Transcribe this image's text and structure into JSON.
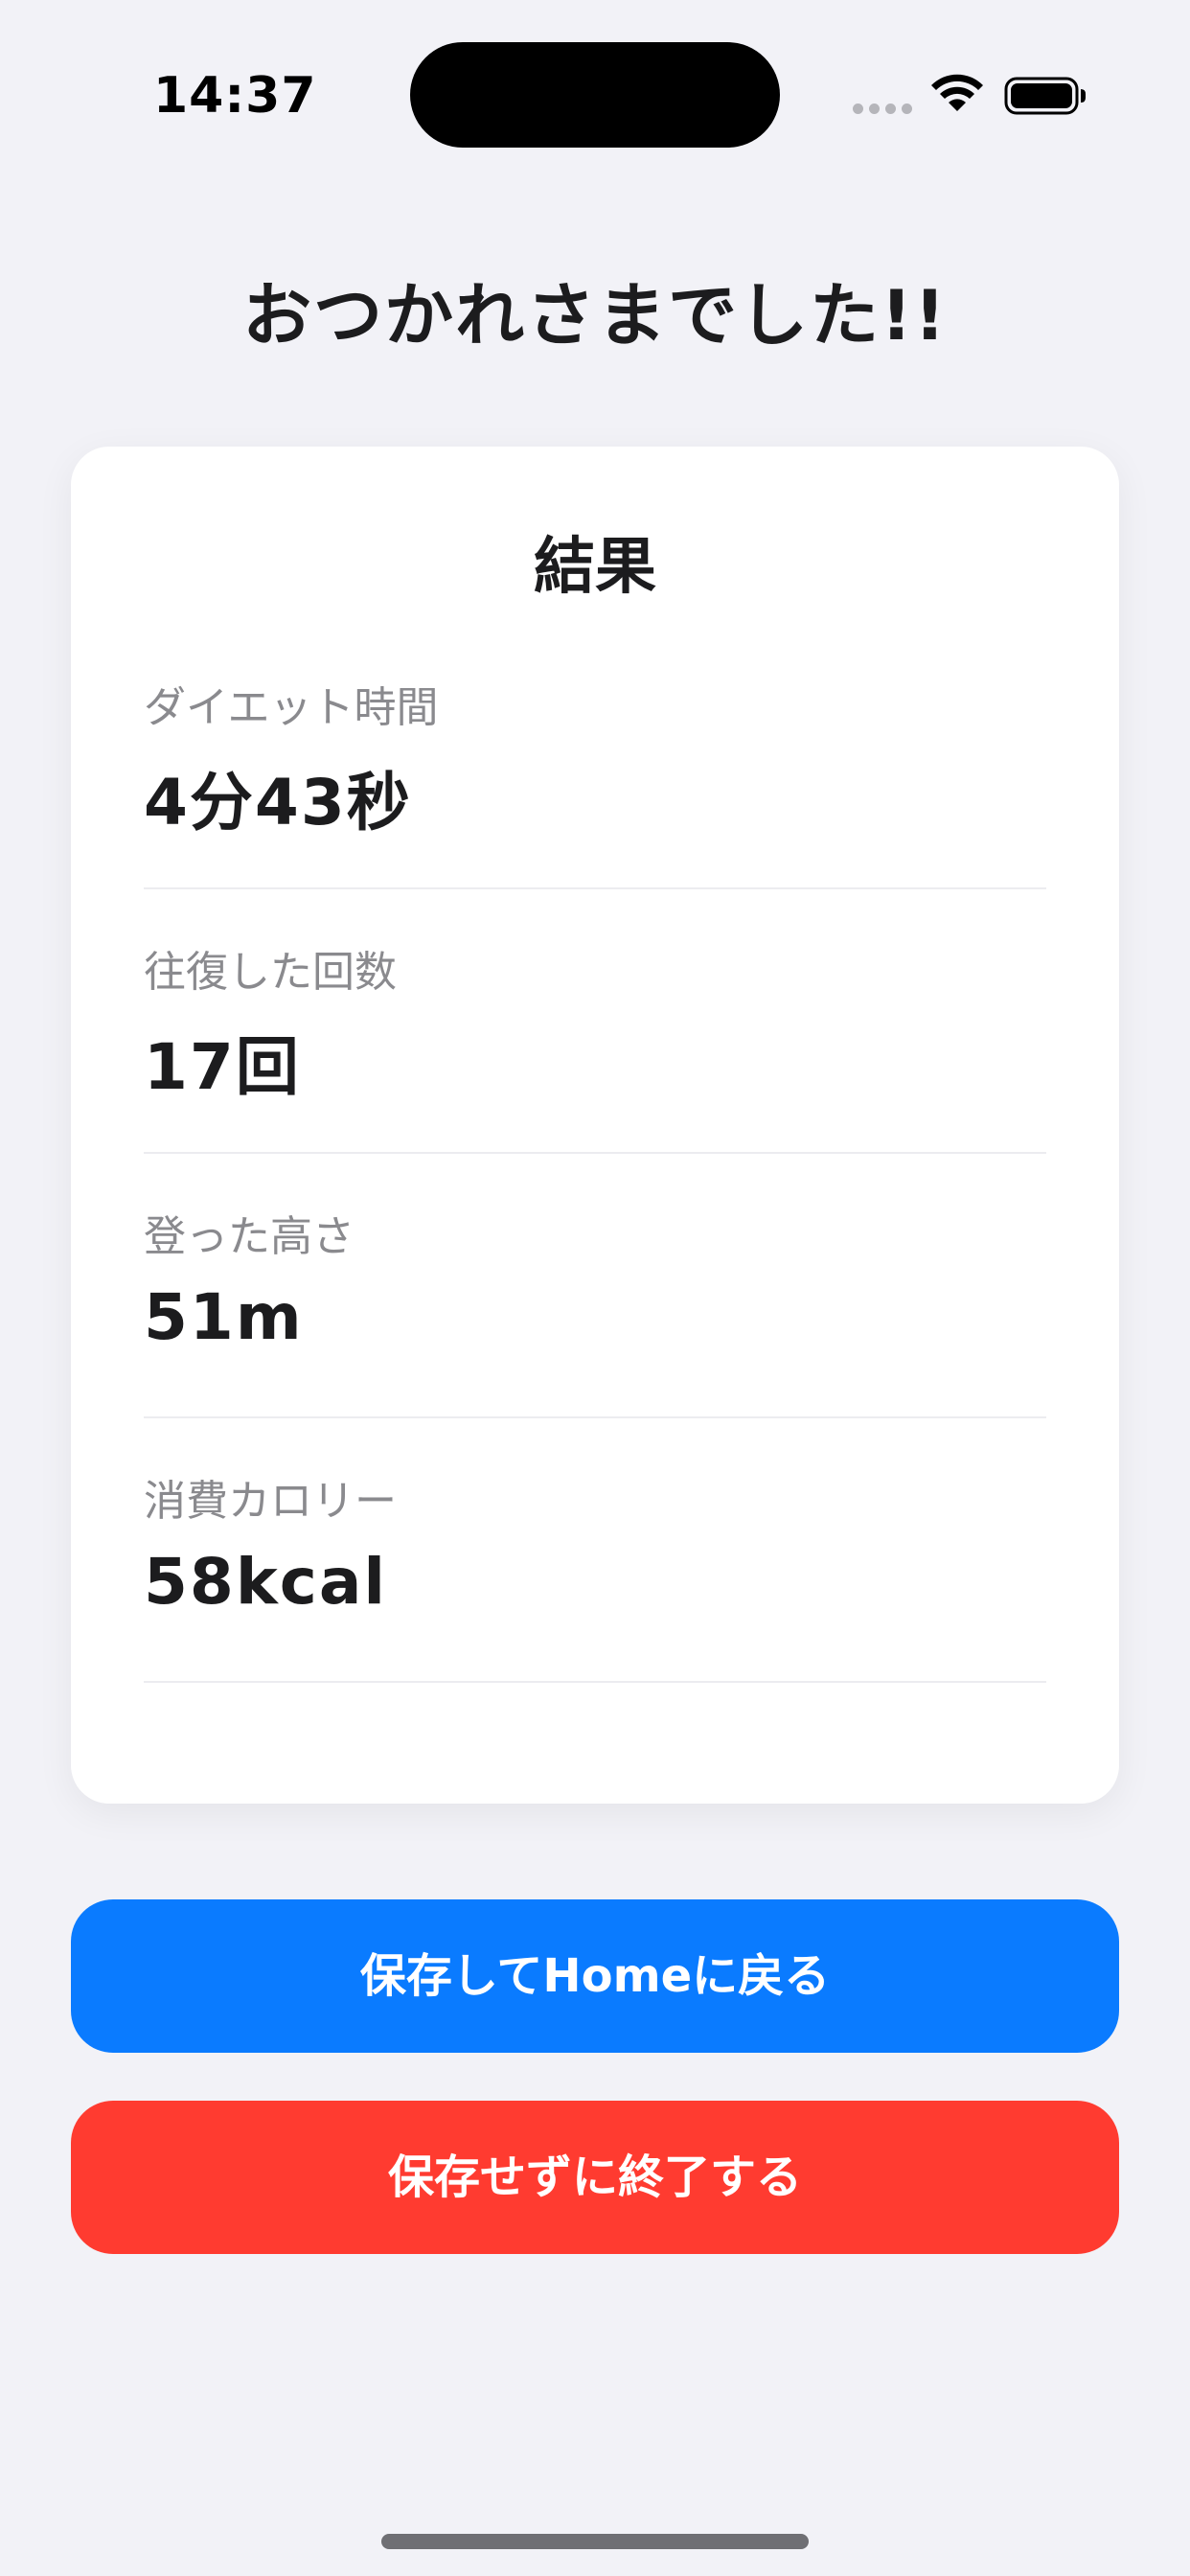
{
  "status_bar": {
    "time": "14:37",
    "icons": [
      "signal-dots-icon",
      "wifi-icon",
      "battery-icon"
    ]
  },
  "page": {
    "title": "おつかれさまでした!!"
  },
  "results": {
    "title": "結果",
    "stats": [
      {
        "label": "ダイエット時間",
        "value": "4分43秒"
      },
      {
        "label": "往復した回数",
        "value": "17回"
      },
      {
        "label": "登った高さ",
        "value": "51m"
      },
      {
        "label": "消費カロリー",
        "value": "58kcal"
      }
    ]
  },
  "actions": {
    "save_home_label": "保存してHomeに戻る",
    "quit_label": "保存せずに終了する"
  },
  "colors": {
    "background": "#f2f2f7",
    "primary": "#0a7bff",
    "destructive": "#ff3b30",
    "text": "#1c1c1e",
    "secondary_text": "#8a8a8e"
  }
}
